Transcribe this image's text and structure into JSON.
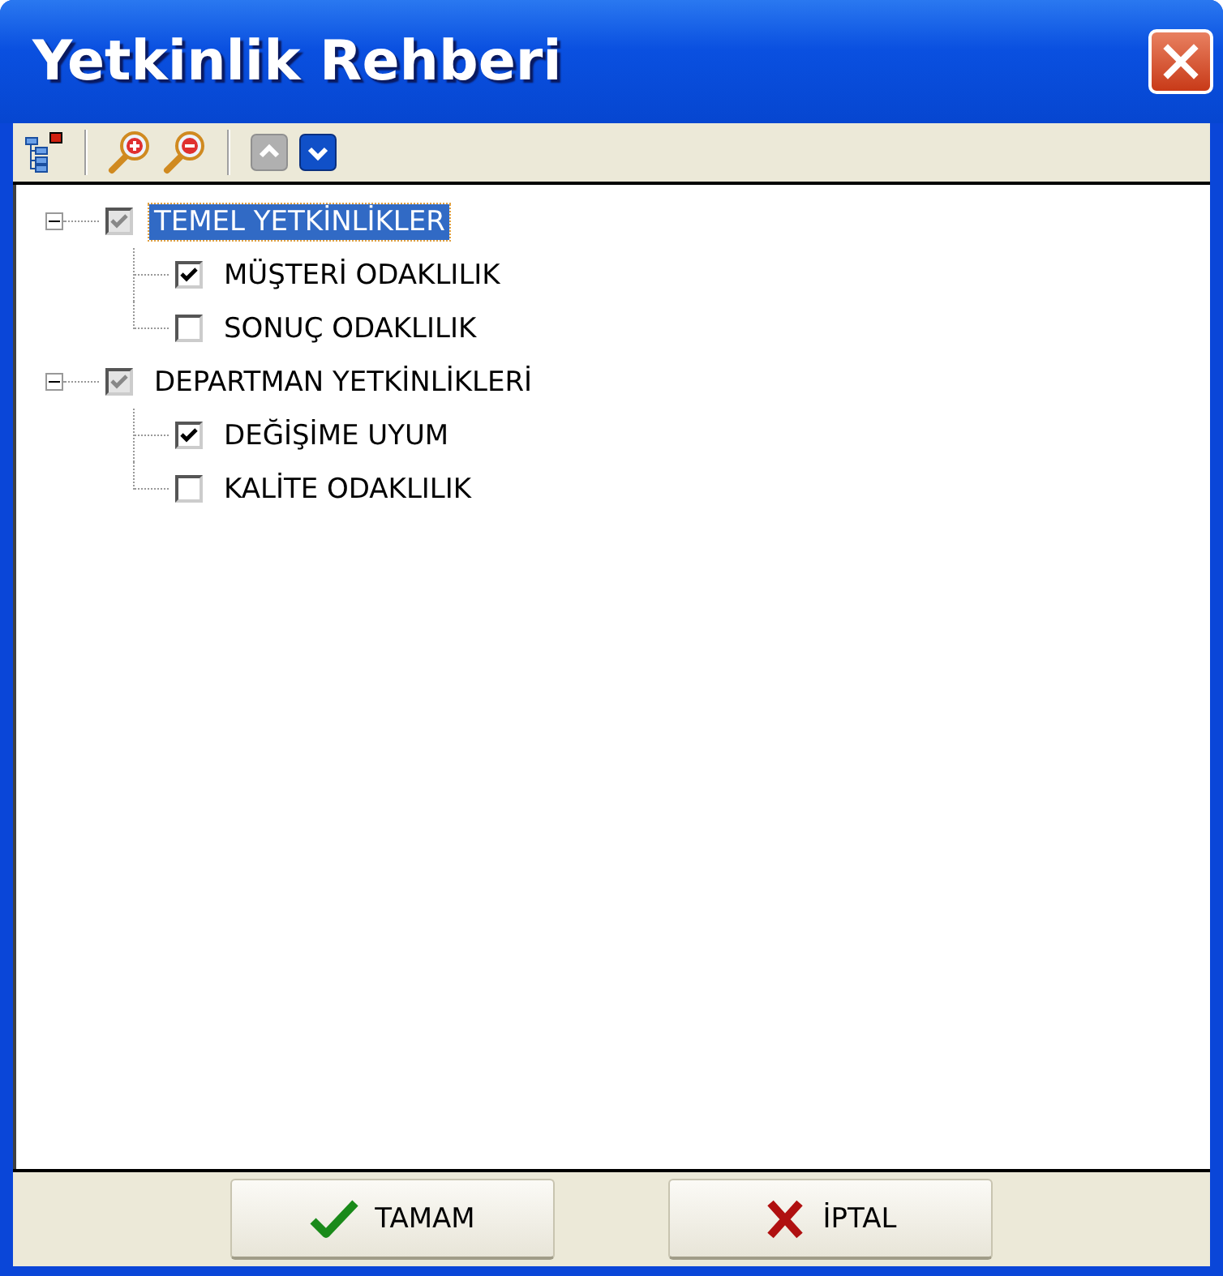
{
  "window": {
    "title": "Yetkinlik Rehberi"
  },
  "toolbar": [
    {
      "kind": "tree"
    },
    {
      "kind": "separator"
    },
    {
      "kind": "zoom-in"
    },
    {
      "kind": "zoom-out"
    },
    {
      "kind": "separator"
    },
    {
      "kind": "up",
      "disabled": true
    },
    {
      "kind": "down",
      "disabled": false
    }
  ],
  "tree": [
    {
      "label": "TEMEL YETKİNLİKLER",
      "expanded": true,
      "checked": true,
      "grayed": true,
      "selected": true,
      "children": [
        {
          "label": "MÜŞTERİ ODAKLILIK",
          "checked": true,
          "selected": false
        },
        {
          "label": "SONUÇ ODAKLILIK",
          "checked": false,
          "selected": false
        }
      ]
    },
    {
      "label": "DEPARTMAN YETKİNLİKLERİ",
      "expanded": true,
      "checked": true,
      "grayed": true,
      "selected": false,
      "children": [
        {
          "label": "DEĞİŞİME UYUM",
          "checked": true,
          "selected": false
        },
        {
          "label": "KALİTE ODAKLILIK",
          "checked": false,
          "selected": false
        }
      ]
    }
  ],
  "buttons": [
    {
      "kind": "ok",
      "label": "TAMAM"
    },
    {
      "kind": "cancel",
      "label": "İPTAL"
    }
  ]
}
